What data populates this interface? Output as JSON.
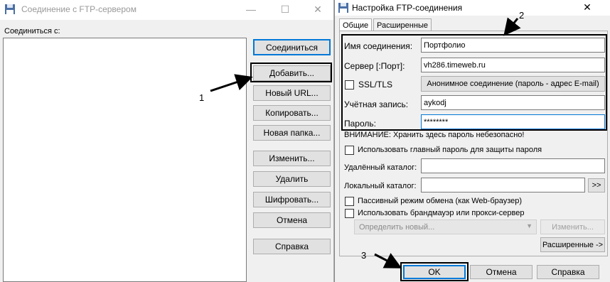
{
  "left_window": {
    "title": "Соединение с FTP-сервером",
    "connect_to_label": "Соединиться с:",
    "buttons": {
      "connect": "Соединиться",
      "add": "Добавить...",
      "new_url": "Новый URL...",
      "copy": "Копировать...",
      "new_folder": "Новая папка...",
      "edit": "Изменить...",
      "delete": "Удалить",
      "encrypt": "Шифровать...",
      "cancel": "Отмена",
      "help": "Справка"
    }
  },
  "right_window": {
    "title": "Настройка FTP-соединения",
    "tabs": [
      "Общие",
      "Расширенные"
    ],
    "fields": {
      "connection_name_label": "Имя соединения:",
      "connection_name_value": "Портфолио",
      "server_label": "Сервер [:Порт]:",
      "server_value": "vh286.timeweb.ru",
      "ssl_label": "SSL/TLS",
      "anonymous_button": "Анонимное соединение (пароль - адрес E-mail)",
      "account_label": "Учётная запись:",
      "account_value": "aykodj",
      "password_label": "Пароль:",
      "password_value": "********"
    },
    "warning": "ВНИМАНИЕ: Хранить здесь пароль небезопасно!",
    "use_master_password": "Использовать главный пароль для защиты пароля",
    "remote_dir_label": "Удалённый каталог:",
    "local_dir_label": "Локальный каталог:",
    "browse_button": ">>",
    "passive_mode": "Пассивный режим обмена (как Web-браузер)",
    "use_firewall": "Использовать брандмауэр или прокси-сервер",
    "firewall_select": "Определить новый...",
    "firewall_edit": "Изменить...",
    "advanced_button": "Расширенные ->",
    "bottom_buttons": {
      "ok": "OK",
      "cancel": "Отмена",
      "help": "Справка"
    }
  },
  "annotations": [
    "1",
    "2",
    "3"
  ]
}
